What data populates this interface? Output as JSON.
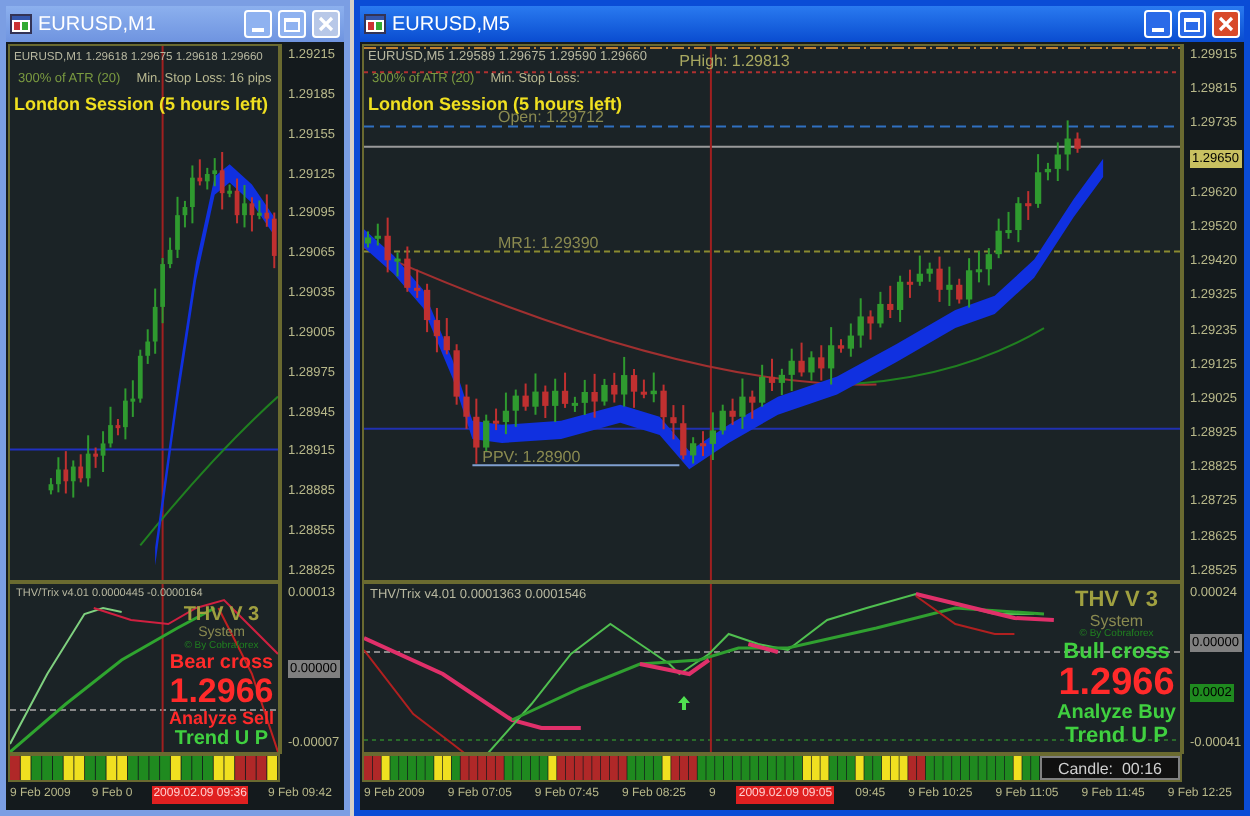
{
  "windows": [
    {
      "title": "EURUSD,M1",
      "active": false,
      "header": "EURUSD,M1  1.29618 1.29675 1.29618 1.29660",
      "atr": "300% of ATR (20)",
      "stop_loss": "Min. Stop Loss:  16 pips",
      "session": "London Session (5 hours left)",
      "price_axis": [
        {
          "label": "1.29215",
          "kind": "tick"
        },
        {
          "label": "1.29185",
          "kind": "tick"
        },
        {
          "label": "1.29155",
          "kind": "tick"
        },
        {
          "label": "1.29125",
          "kind": "tick"
        },
        {
          "label": "1.29095",
          "kind": "tick"
        },
        {
          "label": "1.29065",
          "kind": "tick"
        },
        {
          "label": "1.29035",
          "kind": "tick"
        },
        {
          "label": "1.29005",
          "kind": "tick"
        },
        {
          "label": "1.28975",
          "kind": "tick"
        },
        {
          "label": "1.28945",
          "kind": "tick"
        },
        {
          "label": "1.28915",
          "kind": "tick"
        },
        {
          "label": "1.28885",
          "kind": "tick"
        },
        {
          "label": "1.28855",
          "kind": "tick"
        },
        {
          "label": "1.28825",
          "kind": "tick"
        }
      ],
      "indicator": {
        "title": "THV/Trix v4.01 0.0000445 -0.0000164",
        "brand": "THV V 3",
        "system": "System",
        "credit": "© By Cobraforex",
        "cross": "Bear cross",
        "price": "1.2966",
        "analyze": "Analyze Sell",
        "color": "#ff2a2a",
        "trend": "Trend U P",
        "axis": [
          {
            "label": "0.00013",
            "kind": "tick"
          },
          {
            "label": "0.00000",
            "kind": "marker"
          },
          {
            "label": "-0.00007",
            "kind": "tick"
          }
        ]
      },
      "time_axis": [
        {
          "label": "9 Feb 2009",
          "highlighted": false
        },
        {
          "label": "9 Feb 0",
          "highlighted": false
        },
        {
          "label": "2009.02.09 09:36",
          "highlighted": true
        },
        {
          "label": "9 Feb 09:42",
          "highlighted": false
        }
      ]
    },
    {
      "title": "EURUSD,M5",
      "active": true,
      "header": "EURUSD,M5  1.29589 1.29675 1.29590 1.29660",
      "atr": "300% of ATR (20)",
      "stop_loss": "Min. Stop Loss:",
      "session": "London Session (5 hours left)",
      "levels": [
        {
          "label": "PHigh: 1.29813",
          "kind": "high"
        },
        {
          "label": "Open: 1.29712",
          "kind": "open"
        },
        {
          "label": "MR1: 1.29390",
          "kind": "pivot"
        },
        {
          "label": "PPV: 1.28900",
          "kind": "low"
        }
      ],
      "price_axis": [
        {
          "label": "1.29915",
          "kind": "tick"
        },
        {
          "label": "1.29815",
          "kind": "tick"
        },
        {
          "label": "1.29735",
          "kind": "tick"
        },
        {
          "label": "1.29650",
          "kind": "current"
        },
        {
          "label": "1.29620",
          "kind": "tick"
        },
        {
          "label": "1.29520",
          "kind": "tick"
        },
        {
          "label": "1.29420",
          "kind": "tick"
        },
        {
          "label": "1.29325",
          "kind": "tick"
        },
        {
          "label": "1.29235",
          "kind": "tick"
        },
        {
          "label": "1.29125",
          "kind": "tick"
        },
        {
          "label": "1.29025",
          "kind": "tick"
        },
        {
          "label": "1.28925",
          "kind": "tick"
        },
        {
          "label": "1.28825",
          "kind": "tick"
        },
        {
          "label": "1.28725",
          "kind": "tick"
        },
        {
          "label": "1.28625",
          "kind": "tick"
        },
        {
          "label": "1.28525",
          "kind": "tick"
        }
      ],
      "indicator": {
        "title": "THV/Trix v4.01 0.0001363 0.0001546",
        "brand": "THV V 3",
        "system": "System",
        "credit": "© By Cobraforex",
        "cross": "Bull cross",
        "price": "1.2966",
        "analyze": "Analyze Buy",
        "color": "#40d040",
        "trend": "Trend U P",
        "markers": [
          {
            "kind": "up_arrow"
          }
        ],
        "axis": [
          {
            "label": "0.00024",
            "kind": "tick"
          },
          {
            "label": "0.00000",
            "kind": "marker"
          },
          {
            "label": "0.0002",
            "kind": "signal"
          },
          {
            "label": "-0.00041",
            "kind": "tick"
          }
        ]
      },
      "candle_timer": "Candle:  00:16",
      "time_axis": [
        {
          "label": "9 Feb 2009",
          "highlighted": false
        },
        {
          "label": "9 Feb 07:05",
          "highlighted": false
        },
        {
          "label": "9 Feb 07:45",
          "highlighted": false
        },
        {
          "label": "9 Feb 08:25",
          "highlighted": false
        },
        {
          "label": "9",
          "highlighted": false
        },
        {
          "label": "2009.02.09 09:05",
          "highlighted": true
        },
        {
          "label": "09:45",
          "highlighted": false
        },
        {
          "label": "9 Feb 10:25",
          "highlighted": false
        },
        {
          "label": "9 Feb 11:05",
          "highlighted": false
        },
        {
          "label": "9 Feb 11:45",
          "highlighted": false
        },
        {
          "label": "9 Feb 12:25",
          "highlighted": false
        }
      ]
    }
  ]
}
